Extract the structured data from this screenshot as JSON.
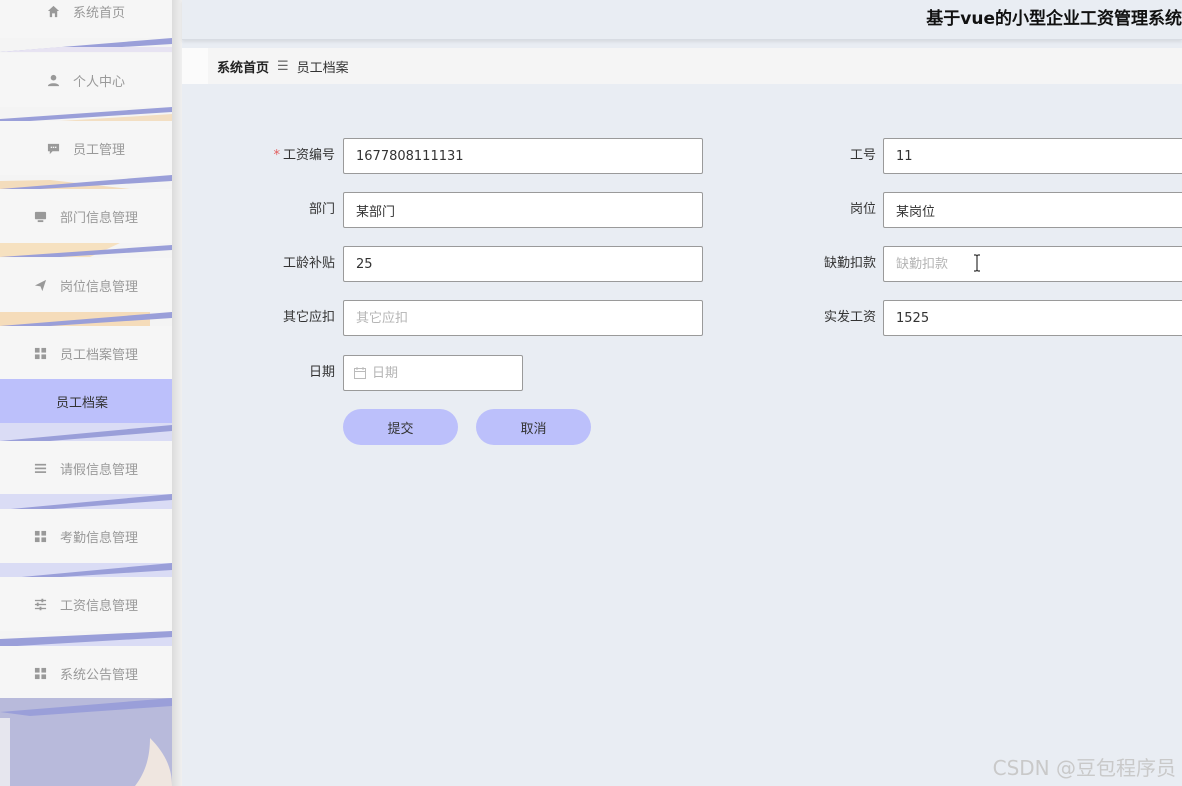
{
  "app": {
    "title": "基于vue的小型企业工资管理系统"
  },
  "breadcrumb": {
    "home": "系统首页",
    "separator": "☰",
    "current": "员工档案"
  },
  "sidebar": {
    "items": [
      {
        "label": "系统首页",
        "icon": "home-icon"
      },
      {
        "label": "个人中心",
        "icon": "user-icon"
      },
      {
        "label": "员工管理",
        "icon": "chat-icon"
      },
      {
        "label": "部门信息管理",
        "icon": "monitor-icon"
      },
      {
        "label": "岗位信息管理",
        "icon": "send-icon"
      },
      {
        "label": "员工档案管理",
        "icon": "grid-icon"
      },
      {
        "label": "员工档案",
        "icon": ""
      },
      {
        "label": "请假信息管理",
        "icon": "list-icon"
      },
      {
        "label": "考勤信息管理",
        "icon": "grid-icon"
      },
      {
        "label": "工资信息管理",
        "icon": "sliders-icon"
      },
      {
        "label": "系统公告管理",
        "icon": "grid-icon"
      }
    ],
    "active_color": "#bcc0fb"
  },
  "form": {
    "salary_no": {
      "label": "工资编号",
      "required": "*",
      "value": "1677808111131"
    },
    "employee_no": {
      "label": "工号",
      "value": "11"
    },
    "department": {
      "label": "部门",
      "value": "某部门"
    },
    "position": {
      "label": "岗位",
      "value": "某岗位"
    },
    "seniority_allowance": {
      "label": "工龄补贴",
      "value": "25"
    },
    "absence_deduction": {
      "label": "缺勤扣款",
      "value": "",
      "placeholder": "缺勤扣款"
    },
    "other_deduction": {
      "label": "其它应扣",
      "value": "",
      "placeholder": "其它应扣"
    },
    "net_salary": {
      "label": "实发工资",
      "value": "1525"
    },
    "date": {
      "label": "日期",
      "value": "",
      "placeholder": "日期"
    },
    "submit_label": "提交",
    "cancel_label": "取消"
  },
  "watermark": "CSDN @豆包程序员"
}
